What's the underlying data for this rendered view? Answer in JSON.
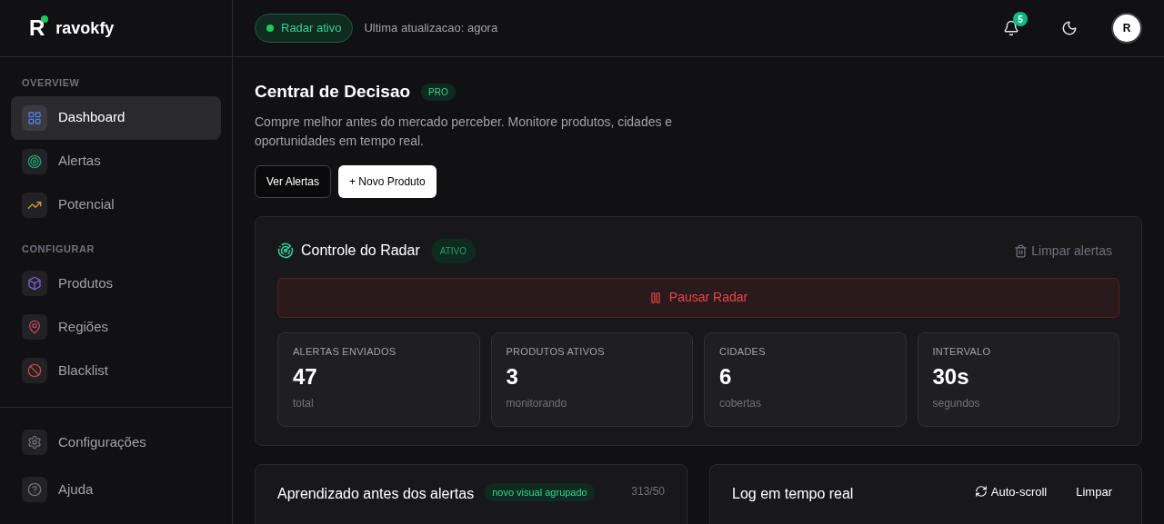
{
  "brand": {
    "logo_letter": "R",
    "name": "ravokfy"
  },
  "sidebar": {
    "sections": [
      {
        "title": "OVERVIEW",
        "items": [
          {
            "label": "Dashboard",
            "selected": true
          },
          {
            "label": "Alertas",
            "selected": false
          },
          {
            "label": "Potencial",
            "selected": false
          }
        ]
      },
      {
        "title": "CONFIGURAR",
        "items": [
          {
            "label": "Produtos",
            "selected": false
          },
          {
            "label": "Regiões",
            "selected": false
          },
          {
            "label": "Blacklist",
            "selected": false
          }
        ]
      }
    ],
    "footer_items": [
      {
        "label": "Configurações"
      },
      {
        "label": "Ajuda"
      }
    ]
  },
  "topbar": {
    "status": {
      "label": "Radar ativo"
    },
    "last_update": "Ultima atualizacao: agora",
    "notifications": "5",
    "avatar": "R"
  },
  "hero": {
    "title": "Central de Decisao",
    "badge": "PRO",
    "description": "Compre melhor antes do mercado perceber. Monitore produtos, cidades e oportunidades em tempo real.",
    "buttons": [
      {
        "label": "Ver Alertas",
        "kind": "outline"
      },
      {
        "label": "+ Novo Produto",
        "kind": "solid"
      }
    ]
  },
  "radar": {
    "title": "Controle do Radar",
    "badge": "ATIVO",
    "clear": "Limpar alertas",
    "pause": "Pausar Radar",
    "stats": [
      {
        "label": "ALERTAS ENVIADOS",
        "value": "47",
        "unit": "total"
      },
      {
        "label": "PRODUTOS ATIVOS",
        "value": "3",
        "unit": "monitorando"
      },
      {
        "label": "CIDADES",
        "value": "6",
        "unit": "cobertas"
      },
      {
        "label": "INTERVALO",
        "value": "30s",
        "unit": "segundos"
      }
    ]
  },
  "learning": {
    "title": "Aprendizado antes dos alertas",
    "badge": "novo visual agrupado",
    "count": "313/50"
  },
  "log": {
    "title": "Log em tempo real",
    "autoscroll": "Auto-scroll",
    "clear": "Limpar"
  }
}
